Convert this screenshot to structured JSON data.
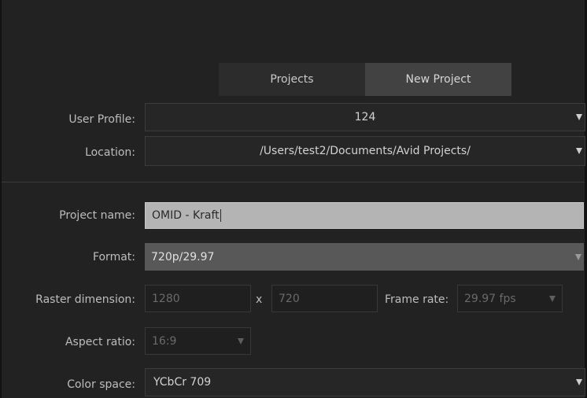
{
  "tabs": [
    {
      "label": "Projects",
      "active": false
    },
    {
      "label": "New Project",
      "active": true
    }
  ],
  "user_profile": {
    "label": "User Profile:",
    "value": "124"
  },
  "location": {
    "label": "Location:",
    "value": "/Users/test2/Documents/Avid Projects/"
  },
  "project_name": {
    "label": "Project name:",
    "value": "OMID - Kraft"
  },
  "format": {
    "label": "Format:",
    "value": "720p/29.97"
  },
  "raster_dimension": {
    "label": "Raster dimension:",
    "width": "1280",
    "separator": "x",
    "height": "720"
  },
  "frame_rate": {
    "label": "Frame rate:",
    "value": "29.97 fps"
  },
  "aspect_ratio": {
    "label": "Aspect ratio:",
    "value": "16:9"
  },
  "color_space": {
    "label": "Color space:",
    "value": "YCbCr 709"
  },
  "icons": {
    "dropdown": "triangle-down"
  }
}
